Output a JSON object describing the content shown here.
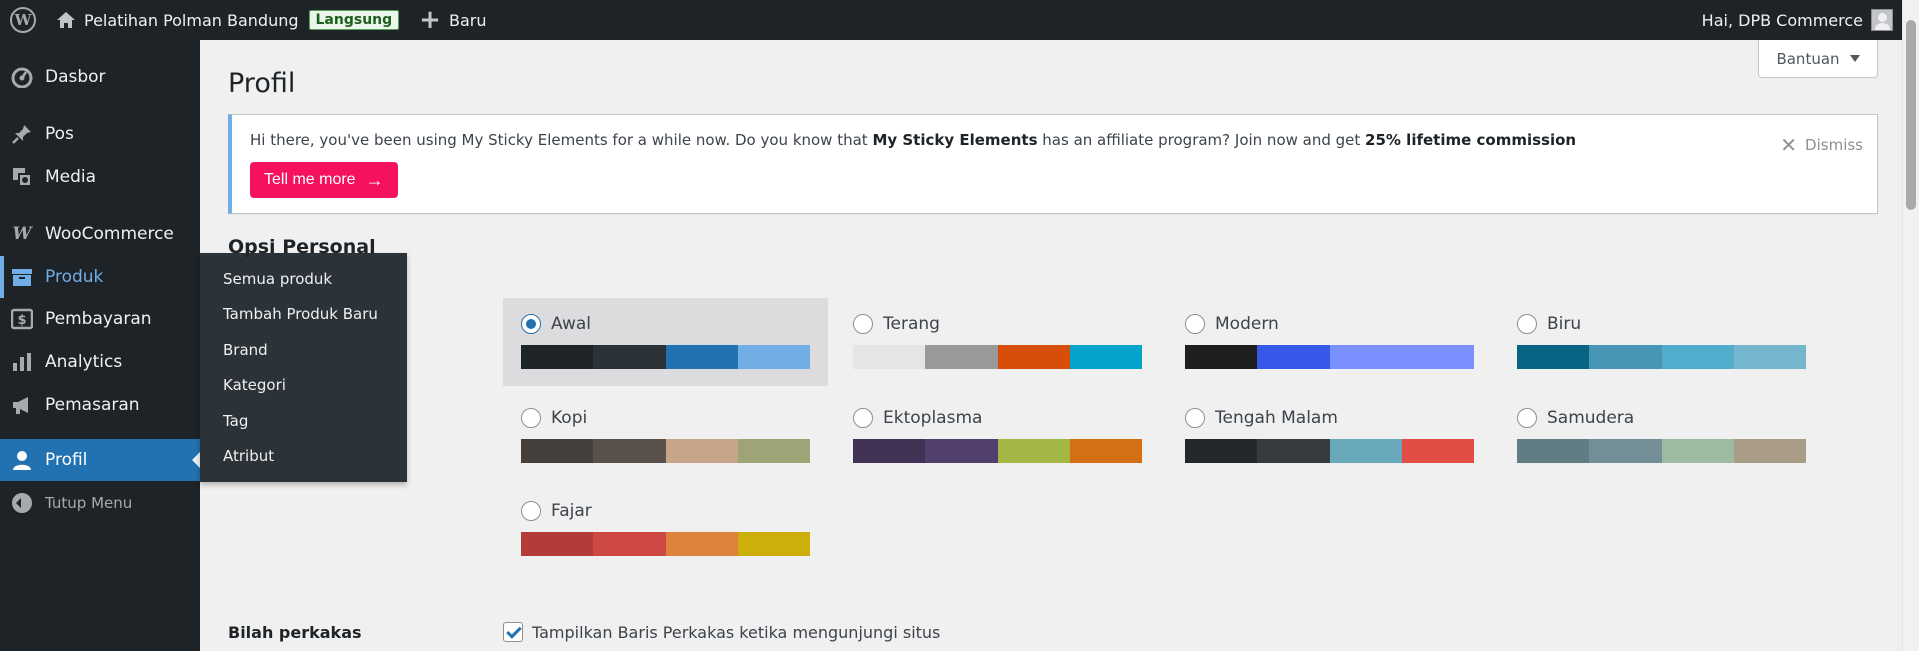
{
  "adminbar": {
    "site_name": "Pelatihan Polman Bandung",
    "badge": "Langsung",
    "new_label": "Baru",
    "greeting": "Hai, DPB Commerce",
    "icons": {
      "logo": "wordpress-icon",
      "home": "home-icon",
      "new": "plus-icon",
      "user": "avatar"
    }
  },
  "sidebar": {
    "items": [
      {
        "label": "Dasbor",
        "icon": "dashboard-icon"
      },
      {
        "label": "Pos",
        "icon": "pin-icon"
      },
      {
        "label": "Media",
        "icon": "media-icon"
      },
      {
        "label": "WooCommerce",
        "icon": "woocommerce-icon"
      },
      {
        "label": "Produk",
        "icon": "archive-icon"
      },
      {
        "label": "Pembayaran",
        "icon": "payment-icon"
      },
      {
        "label": "Analytics",
        "icon": "chart-icon"
      },
      {
        "label": "Pemasaran",
        "icon": "megaphone-icon"
      },
      {
        "label": "Profil",
        "icon": "user-icon"
      }
    ],
    "collapse_label": "Tutup Menu",
    "flyout": [
      "Semua produk",
      "Tambah Produk Baru",
      "Brand",
      "Kategori",
      "Tag",
      "Atribut"
    ]
  },
  "content": {
    "help_label": "Bantuan",
    "page_title": "Profil",
    "notice": {
      "text_1": "Hi there, you've been using My Sticky Elements for a while now. Do you know that ",
      "text_bold_1": "My Sticky Elements",
      "text_2": " has an affiliate program? Join now and get ",
      "text_bold_2": "25% lifetime commission",
      "button_label": "Tell me more",
      "dismiss_label": "Dismiss"
    },
    "section_title": "Opsi Personal",
    "color_schemes": [
      {
        "name": "Awal",
        "selected": true,
        "colors": [
          "#1d2327",
          "#2c3338",
          "#2271b1",
          "#72aee6"
        ]
      },
      {
        "name": "Terang",
        "selected": false,
        "colors": [
          "#e5e5e5",
          "#999999",
          "#d64e07",
          "#04a4cc"
        ]
      },
      {
        "name": "Modern",
        "selected": false,
        "colors": [
          "#1e1e1e",
          "#3858e9",
          "#7b90ff",
          "#7b90ff"
        ]
      },
      {
        "name": "Biru",
        "selected": false,
        "colors": [
          "#096484",
          "#4796b3",
          "#52accc",
          "#74b6ce"
        ]
      },
      {
        "name": "Kopi",
        "selected": false,
        "colors": [
          "#46403c",
          "#59524c",
          "#c7a589",
          "#9ea476"
        ]
      },
      {
        "name": "Ektoplasma",
        "selected": false,
        "colors": [
          "#413256",
          "#523f6d",
          "#a3b745",
          "#d46f15"
        ]
      },
      {
        "name": "Tengah Malam",
        "selected": false,
        "colors": [
          "#25282b",
          "#363b3f",
          "#69a8bb",
          "#e14d43"
        ]
      },
      {
        "name": "Samudera",
        "selected": false,
        "colors": [
          "#627c83",
          "#738e96",
          "#9ebaa0",
          "#aa9d88"
        ]
      },
      {
        "name": "Fajar",
        "selected": false,
        "colors": [
          "#b43c38",
          "#cf4944",
          "#dd823b",
          "#ccaf0b"
        ]
      }
    ],
    "toolbar": {
      "label": "Bilah perkakas",
      "checkbox_label": "Tampilkan Baris Perkakas ketika mengunjungi situs",
      "checked": true
    }
  }
}
